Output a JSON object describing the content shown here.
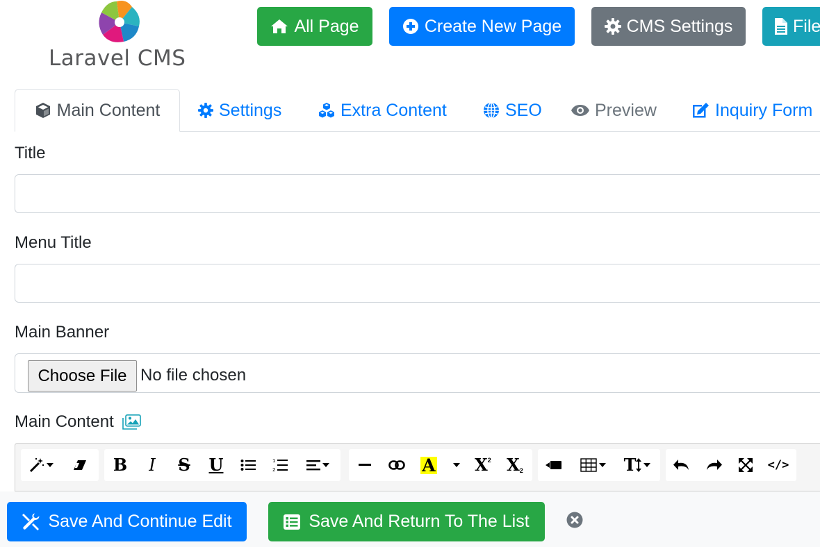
{
  "brand": {
    "name": "Laravel CMS"
  },
  "header": {
    "buttons": [
      {
        "label": "All Page",
        "icon": "home-icon",
        "color": "#28a745"
      },
      {
        "label": "Create New Page",
        "icon": "plus-circle-icon",
        "color": "#007bff"
      },
      {
        "label": "CMS Settings",
        "icon": "gear-icon",
        "color": "#6c757d"
      },
      {
        "label": "File",
        "icon": "file-icon",
        "color": "#17a2b8"
      }
    ]
  },
  "tabs": [
    {
      "label": "Main Content",
      "icon": "cube-icon",
      "active": true
    },
    {
      "label": "Settings",
      "icon": "gear-icon"
    },
    {
      "label": "Extra Content",
      "icon": "cubes-icon"
    },
    {
      "label": "SEO",
      "icon": "globe-icon"
    },
    {
      "label": "Preview",
      "icon": "eye-icon"
    },
    {
      "label": "Inquiry Form",
      "icon": "edit-icon"
    }
  ],
  "form": {
    "title_label": "Title",
    "title_value": "",
    "menu_title_label": "Menu Title",
    "menu_title_value": "",
    "banner_label": "Main Banner",
    "file_button": "Choose File",
    "file_status": "No file chosen",
    "content_label": "Main Content"
  },
  "editor": {
    "toolbar": [
      "magic-icon",
      "eraser-icon",
      "bold-icon",
      "italic-icon",
      "strikethrough-icon",
      "underline-icon",
      "unordered-list-icon",
      "ordered-list-icon",
      "align-icon",
      "horizontal-rule-icon",
      "link-icon",
      "font-color-icon",
      "superscript-icon",
      "subscript-icon",
      "video-icon",
      "table-icon",
      "text-height-icon",
      "undo-icon",
      "redo-icon",
      "fullscreen-icon",
      "code-view-icon"
    ],
    "highlight_color": "#ffff00"
  },
  "footer": {
    "save_continue": "Save And Continue Edit",
    "save_return": "Save And Return To The List"
  },
  "colors": {
    "primary": "#007bff",
    "success": "#28a745",
    "secondary": "#6c757d",
    "info": "#17a2b8"
  }
}
